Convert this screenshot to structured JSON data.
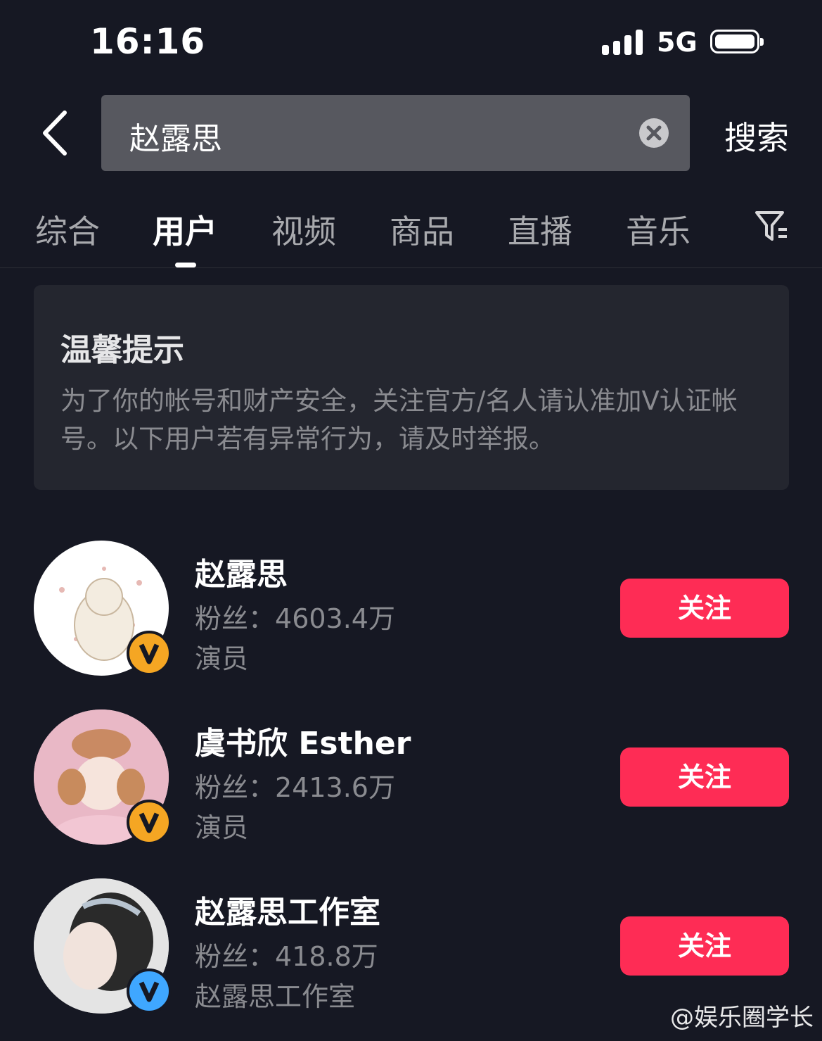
{
  "status_bar": {
    "time": "16:16",
    "network": "5G"
  },
  "search": {
    "query": "赵露思",
    "button_label": "搜索"
  },
  "tabs": [
    {
      "label": "综合",
      "active": false
    },
    {
      "label": "用户",
      "active": true
    },
    {
      "label": "视频",
      "active": false
    },
    {
      "label": "商品",
      "active": false
    },
    {
      "label": "直播",
      "active": false
    },
    {
      "label": "音乐",
      "active": false
    }
  ],
  "notice": {
    "title": "温馨提示",
    "body": "为了你的帐号和财产安全，关注官方/名人请认准加V认证帐号。以下用户若有异常行为，请及时举报。"
  },
  "users": [
    {
      "name": "赵露思",
      "fans_label": "粉丝：",
      "fans": "4603.4万",
      "desc": "演员",
      "badge_color": "#f5a623",
      "follow_label": "关注"
    },
    {
      "name": "虞书欣 Esther",
      "fans_label": "粉丝：",
      "fans": "2413.6万",
      "desc": "演员",
      "badge_color": "#f5a623",
      "follow_label": "关注"
    },
    {
      "name": "赵露思工作室",
      "fans_label": "粉丝：",
      "fans": "418.8万",
      "desc": "赵露思工作室",
      "badge_color": "#3fa7ff",
      "follow_label": "关注"
    }
  ],
  "watermark": "@娱乐圈学长",
  "colors": {
    "background": "#161823",
    "follow": "#fe2c55",
    "search_box": "#57585f"
  }
}
